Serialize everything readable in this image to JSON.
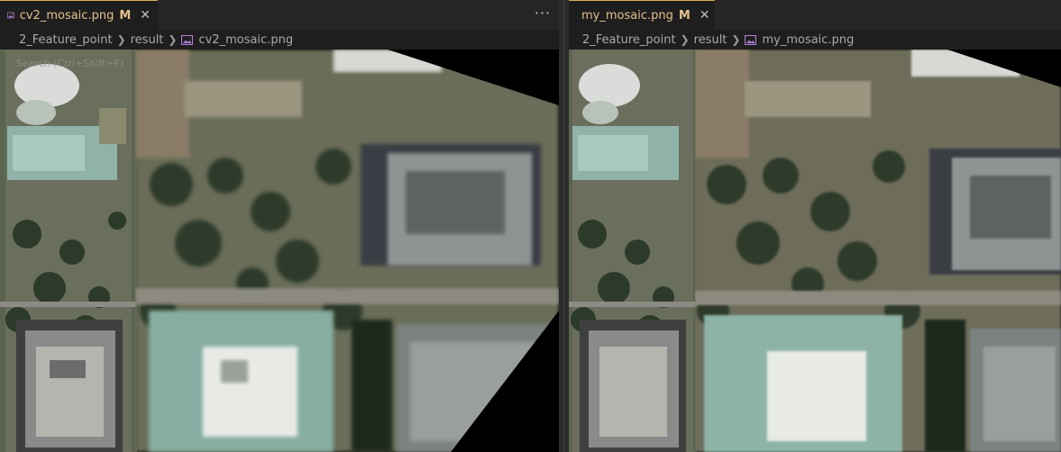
{
  "left_editor": {
    "tab": {
      "file_name": "cv2_mosaic.png",
      "status": "M",
      "close_glyph": "✕"
    },
    "more_actions_glyph": "···",
    "breadcrumb": [
      "2_Feature_point",
      "result",
      "cv2_mosaic.png"
    ],
    "search_hint": "Search (Ctrl+Shift+F)"
  },
  "right_editor": {
    "tab": {
      "file_name": "my_mosaic.png",
      "status": "M",
      "close_glyph": "✕"
    },
    "breadcrumb": [
      "2_Feature_point",
      "result",
      "my_mosaic.png"
    ]
  },
  "colors": {
    "background": "#1e1e1e",
    "tab_bar": "#252526",
    "modified_text": "#e2c08d",
    "image_icon": "#b180d7",
    "breadcrumb_text": "#a9a9a9"
  },
  "icons": [
    "image-file-icon",
    "close-icon",
    "more-actions-icon",
    "chevron-right-icon"
  ]
}
